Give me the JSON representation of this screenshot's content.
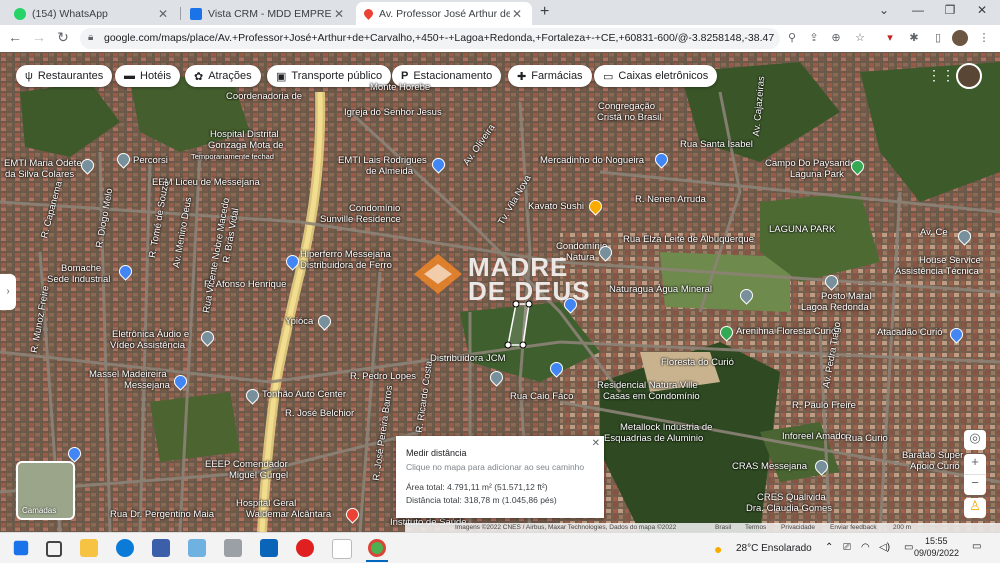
{
  "browser": {
    "tabs": [
      {
        "title": "(154) WhatsApp",
        "icon": "whatsapp-icon",
        "color": "#25d366"
      },
      {
        "title": "Vista CRM - MDD EMPREENDIME",
        "icon": "crm-icon",
        "color": "#1a73e8"
      },
      {
        "title": "Av. Professor José Arthur de Car",
        "icon": "maps-pin-icon",
        "color": "#ea4335"
      }
    ],
    "url": "google.com/maps/place/Av.+Professor+José+Arthur+de+Carvalho,+450+-+Lagoa+Redonda,+Fortaleza+-+CE,+60831-600/@-3.8258148,-38.476..."
  },
  "map": {
    "chips": [
      {
        "label": "Restaurantes",
        "icon": "ψ"
      },
      {
        "label": "Hotéis",
        "icon": "▬"
      },
      {
        "label": "Atrações",
        "icon": "✿"
      },
      {
        "label": "Transporte público",
        "icon": "▣"
      },
      {
        "label": "Estacionamento",
        "icon": "P"
      },
      {
        "label": "Farmácias",
        "icon": "✚"
      },
      {
        "label": "Caixas eletrônicos",
        "icon": "▭"
      }
    ],
    "labels": {
      "l1": "Coordenadoria de",
      "l2": "Monte Horebe",
      "l3": "Igreja do Senhor Jesus",
      "l4": "Hospital Distrital",
      "l5": "Gonzaga Mota de",
      "l6": "Temporariamente fechad",
      "l7": "EMTI Maria Odete",
      "l8": "da Silva Colares",
      "l9": "Percorsi",
      "l10": "EEM Liceu de Messejana",
      "l11": "EMTI Lais Rodrigues",
      "l12": "de Almeida",
      "l13": "Congregação",
      "l14": "Cristã no Brasil",
      "l15": "Mercadinho do Nogueira",
      "l16": "Rua Santa Isabel",
      "l17": "Campo Do Paysandu",
      "l18": "Laguna Park",
      "l19": "Condomínio",
      "l20": "Sunville Residence",
      "l21": "Kavato Sushi",
      "l22": "R. Nenen Arruda",
      "l23": "Rua Elza Leite de Albuquerque",
      "l24": "LAGUNA PARK",
      "l25": "Condomínio",
      "l26": "Natura",
      "l27": "Hiperferro Messejana",
      "l28": "Distribuidora de Ferro",
      "l29": "Bomache",
      "l30": "Sede Industrial",
      "l31": "R. Afonso Henrique",
      "l32": "Naturagua Água Mineral",
      "l33": "House Service",
      "l34": "Assistência Técnica",
      "l35": "Posto Maral",
      "l36": "Lagoa Redonda",
      "l37": "Eletrônica Áudio e",
      "l38": "Vídeo Assistência",
      "l39": "Ypióca",
      "l40": "Arenihna Floresta Curió",
      "l41": "Atacadão Curió",
      "l42": "Distribuidora JCM",
      "l43": "Floresta do Curió",
      "l44": "Massel Madeireira",
      "l45": "Messejana",
      "l46": "R. Pedro Lopes",
      "l47": "Residencial Natura Ville",
      "l48": "Casas em Condomínio",
      "l49": "Tonhão Auto Center",
      "l50": "R. José Belchior",
      "l51": "R. Paulo Freire",
      "l52": "Metallock Industria de",
      "l53": "Esquadrias de Aluminio",
      "l54": "Rua Caio Fáco",
      "l55": "Inforeel Amado",
      "l56": "Rua Curio",
      "l57": "Baratão Super",
      "l58": "Apoio Curió",
      "l59": "CRAS Messejana",
      "l60": "EEEP Comendador",
      "l61": "Miguel Gurgel",
      "l62": "CRES Qualivida",
      "l63": "Dra. Claudia Gomes",
      "l64": "Hospital Geral",
      "l65": "Waldemar Alcântara",
      "l66": "Instituto de Saúde",
      "l67": "Rua Dr. Pergentino Maia",
      "l68": "R. Capanema",
      "l69": "R. Diogo Melo",
      "l70": "Av. Menino Deus",
      "l71": "Rua Vicente Nobre Macedo",
      "l72": "R. Brás Vidal",
      "l73": "R. Munoz Freire",
      "l74": "R. José Pereira Barros",
      "l75": "R. Ricardo Costa",
      "l76": "Av. Cajazeiras",
      "l77": "Av. Oliveira",
      "l78": "R. Tomé de Souza",
      "l79": "Tv. Vila Nova",
      "l80": "Av. Ce",
      "l81": "Av. Pedra Tiago"
    },
    "watermark": {
      "line1": "MADRE",
      "line2": "DE DEUS"
    },
    "measure": {
      "title": "Medir distância",
      "hint": "Clique no mapa para adicionar ao seu caminho",
      "area": "Área total: 4.791,11 m² (51.571,12 ft²)",
      "distance": "Distância total: 318,78 m (1.045,86 pés)"
    },
    "layers_label": "Camadas",
    "footer": {
      "attribution": "Imagens ©2022 CNES / Airbus, Maxar Technologies, Dados do mapa ©2022",
      "brasil": "Brasil",
      "terms": "Termos",
      "privacy": "Privacidade",
      "feedback": "Enviar feedback",
      "scale": "200 m"
    }
  },
  "taskbar": {
    "weather": "28°C  Ensolarado",
    "time": "15:55",
    "date": "09/09/2022"
  }
}
